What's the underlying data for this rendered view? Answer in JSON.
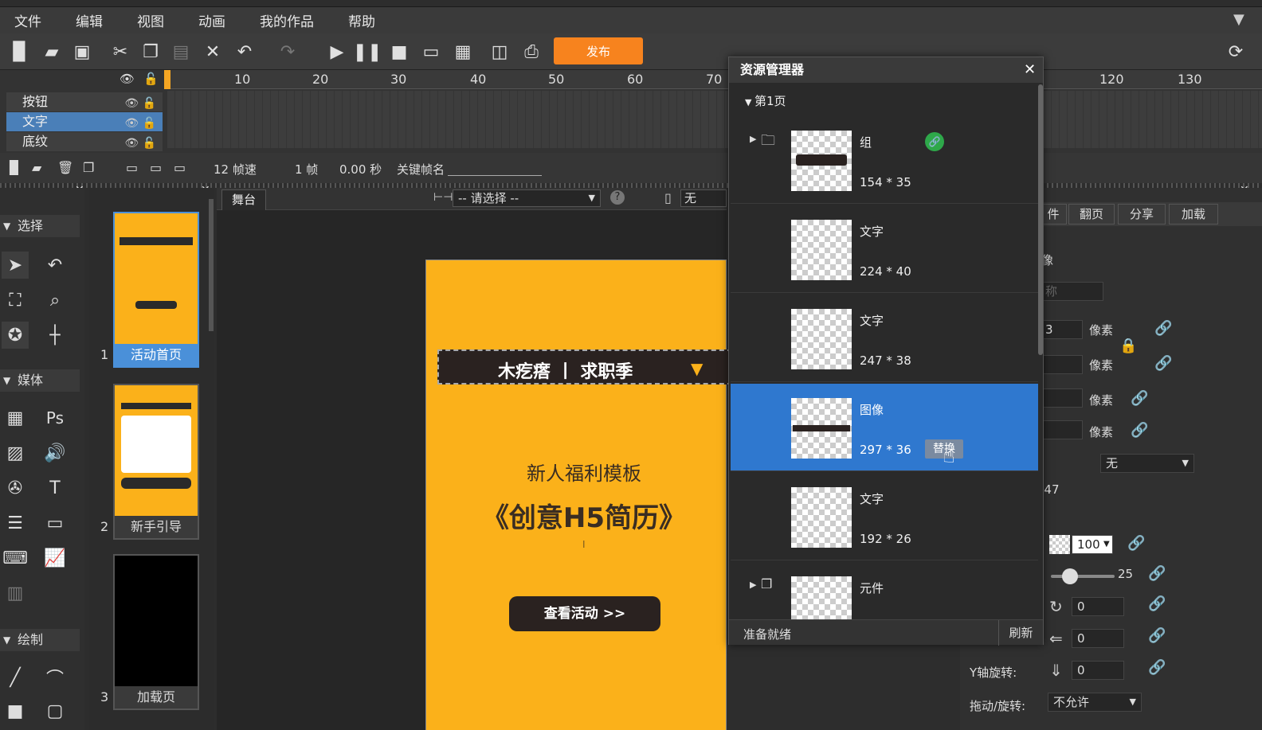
{
  "menu": [
    "文件",
    "编辑",
    "视图",
    "动画",
    "我的作品",
    "帮助"
  ],
  "toolbar": {
    "publish": "发布"
  },
  "timeline": {
    "ticks": [
      "10",
      "20",
      "30",
      "40",
      "50",
      "60",
      "70",
      "120",
      "130"
    ],
    "layers": [
      "按钮",
      "文字",
      "底纹"
    ],
    "fps": "12 帧速",
    "frame": "1 帧",
    "time": "0.00 秒",
    "keyframe_label": "关键帧名"
  },
  "tools": {
    "select": "选择",
    "media": "媒体",
    "draw": "绘制",
    "ps": "Ps",
    "text": "T"
  },
  "pages": [
    {
      "num": "1",
      "label": "活动首页"
    },
    {
      "num": "2",
      "label": "新手引导"
    },
    {
      "num": "3",
      "label": "加载页"
    }
  ],
  "stage": {
    "tab": "舞台",
    "select_placeholder": "-- 请选择 --",
    "device": "无",
    "help": "?"
  },
  "canvas": {
    "banner": "木疙瘩 丨 求职季",
    "subtitle": "新人福利模板",
    "title": "《创意H5简历》",
    "cursor": "I",
    "button": "查看活动 >>"
  },
  "resource": {
    "title": "资源管理器",
    "page": "第1页",
    "status": "准备就绪",
    "refresh": "刷新",
    "replace": "替换",
    "items": [
      {
        "name": "组",
        "size": "154 * 35"
      },
      {
        "name": "文字",
        "size": "224 * 40"
      },
      {
        "name": "文字",
        "size": "247 * 38"
      },
      {
        "name": "图像",
        "size": "297 * 36"
      },
      {
        "name": "文字",
        "size": "192 * 26"
      },
      {
        "name": "元件",
        "size": ""
      }
    ]
  },
  "props": {
    "tabs": [
      "件",
      "翻页",
      "分享",
      "加载"
    ],
    "image_label": "像",
    "name_placeholder": "称",
    "unit": "像素",
    "val3": "3",
    "none": "无",
    "value47": "-47",
    "opacity": "100",
    "slider": "25",
    "rot1": "0",
    "rot2": "0",
    "yrot_label": "Y轴旋转:",
    "yrot": "0",
    "drag_label": "拖动/旋转:",
    "drag": "不允许"
  }
}
